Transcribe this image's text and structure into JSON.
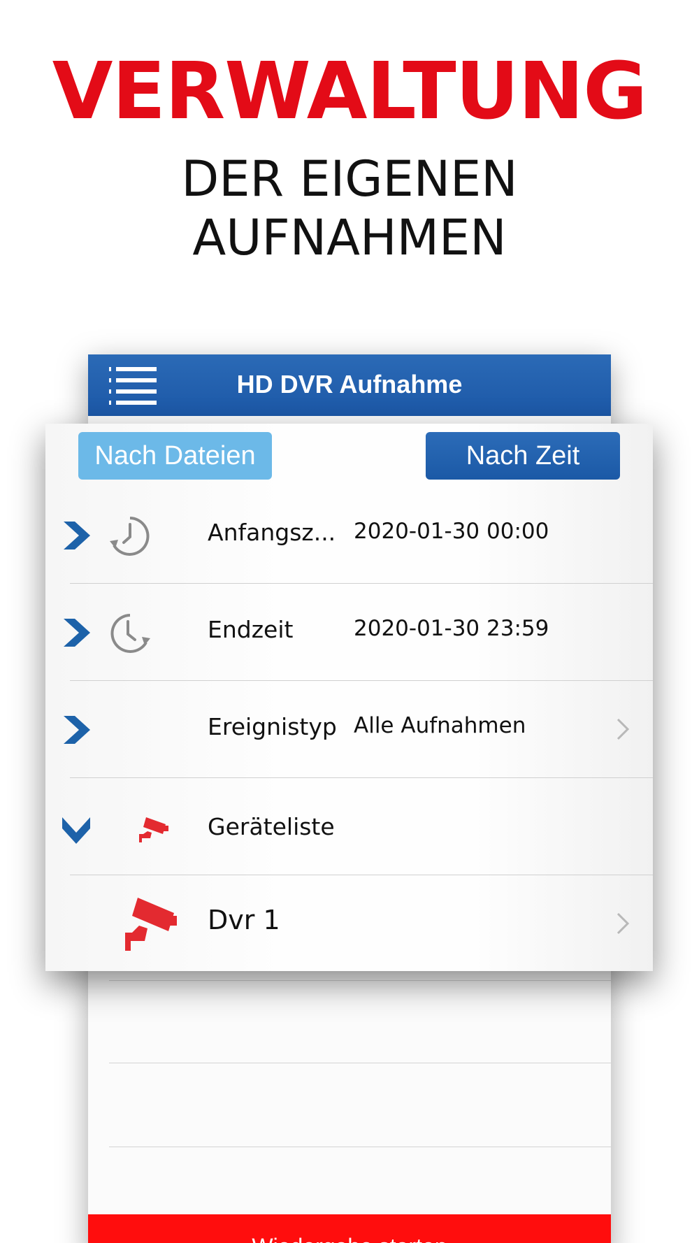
{
  "headline": "VERWALTUNG",
  "subline": [
    "DER EIGENEN",
    "AUFNAHMEN"
  ],
  "app": {
    "title": "HD DVR Aufnahme",
    "accent": "#1c58a7",
    "bottom_button": "Wiedergabe starten"
  },
  "segments": {
    "by_files": "Nach Dateien",
    "by_time": "Nach Zeit",
    "selected": "Nach Zeit"
  },
  "rows": [
    {
      "icon": "clock-rewind-icon",
      "label": "Anfangsz...",
      "value": "2020-01-30 00:00"
    },
    {
      "icon": "clock-forward-icon",
      "label": "Endzeit",
      "value": "2020-01-30 23:59"
    },
    {
      "icon": "",
      "label": "Ereignistyp",
      "value": "Alle Aufnahmen"
    },
    {
      "icon": "camera-icon",
      "label": "Geräteliste",
      "value": ""
    },
    {
      "icon": "camera-icon",
      "label": "Dvr 1",
      "value": ""
    }
  ]
}
